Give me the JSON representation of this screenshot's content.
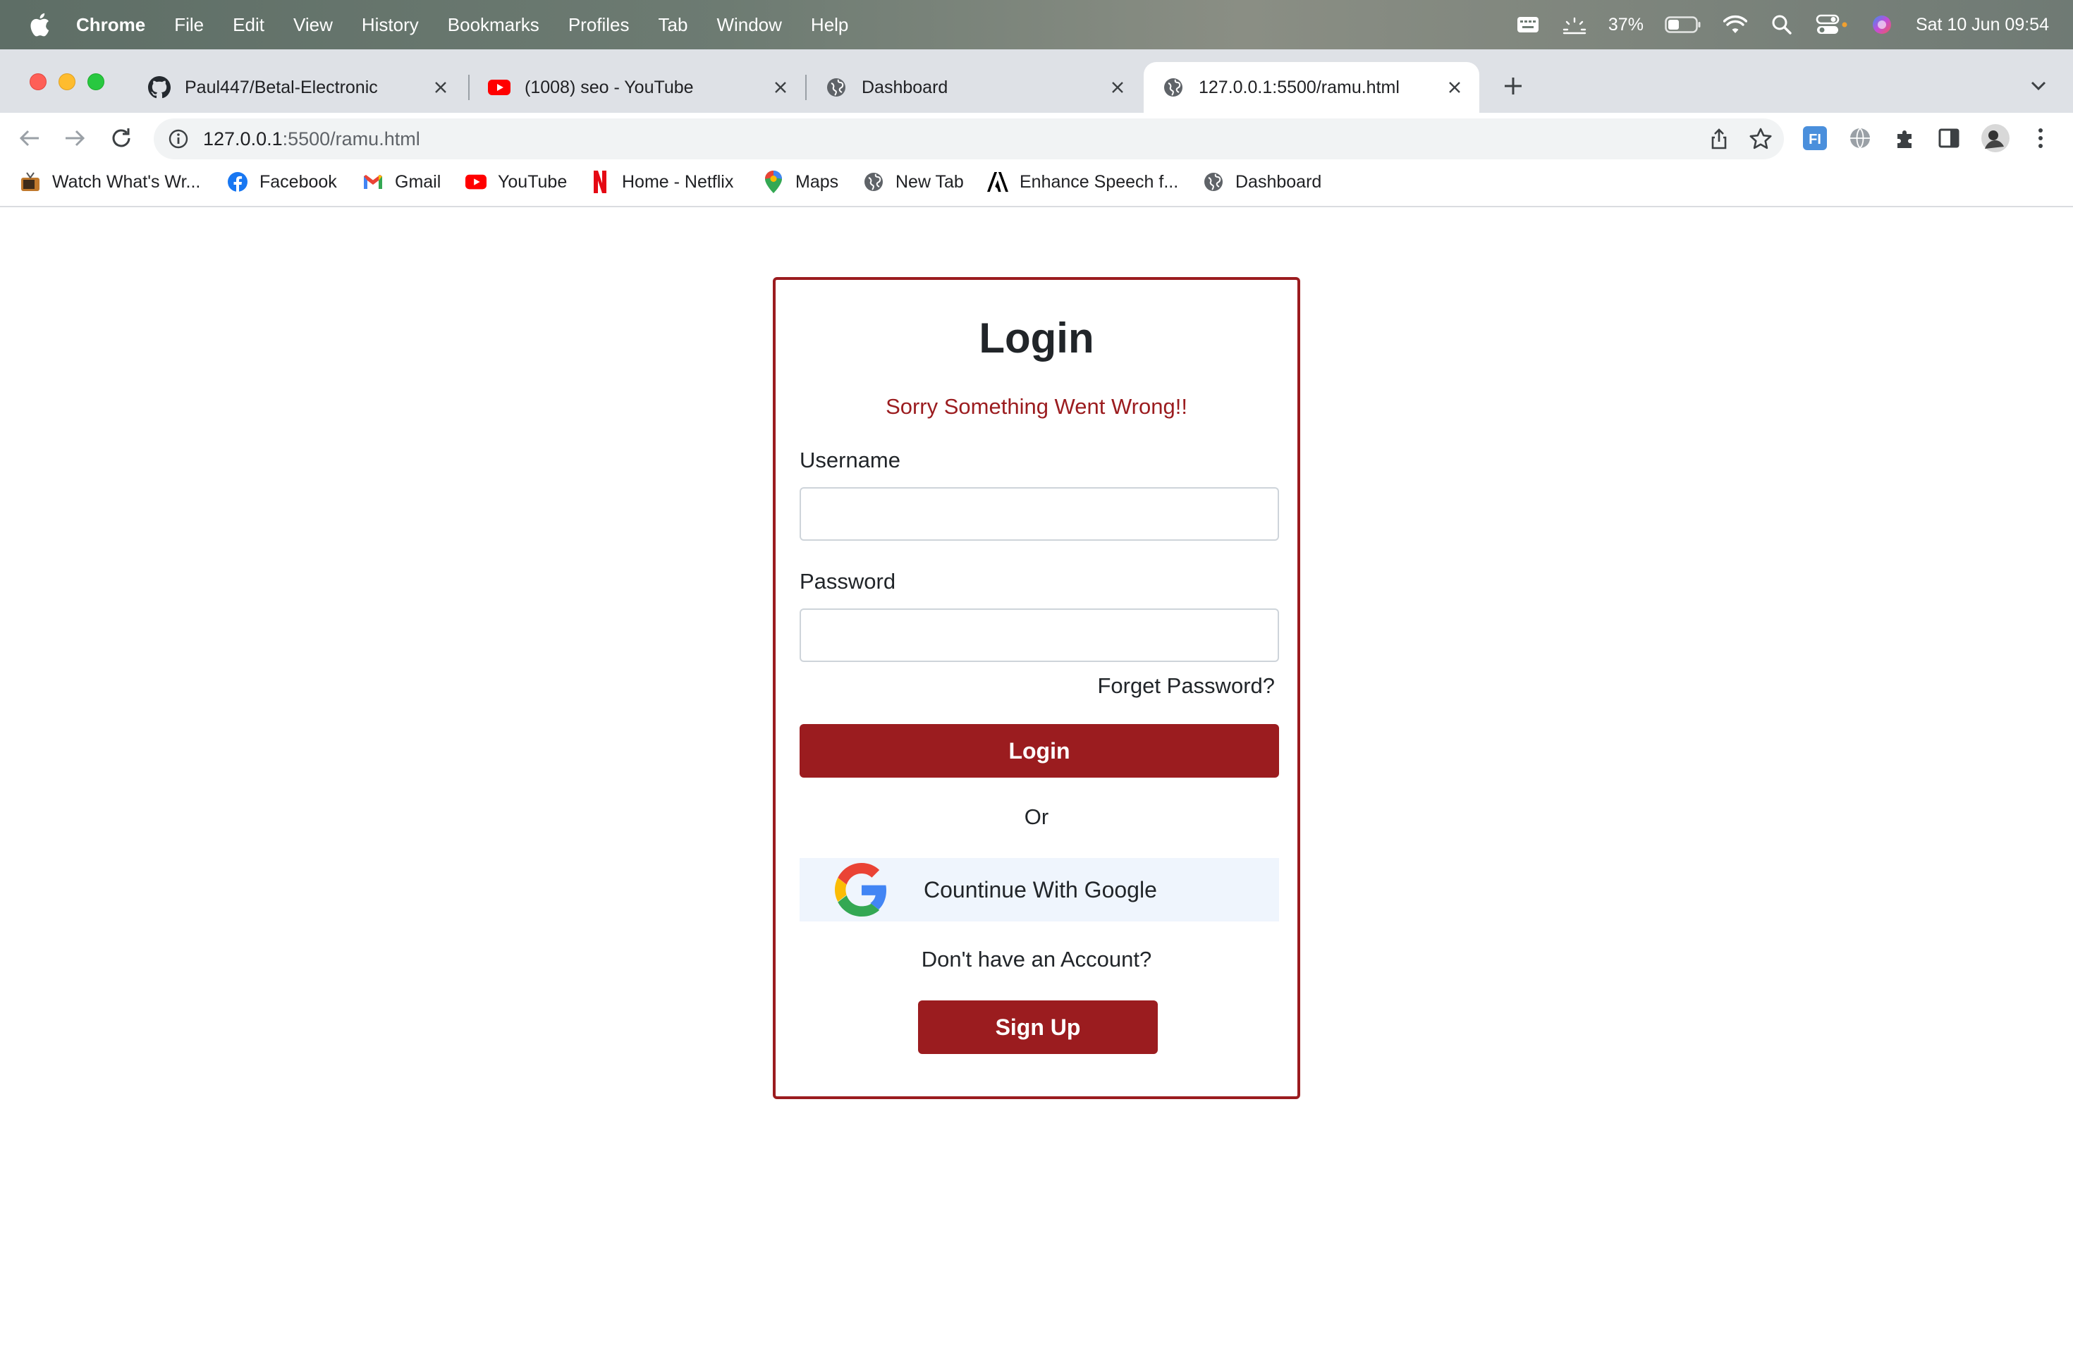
{
  "menubar": {
    "app_name": "Chrome",
    "items": [
      "File",
      "Edit",
      "View",
      "History",
      "Bookmarks",
      "Profiles",
      "Tab",
      "Window",
      "Help"
    ],
    "battery": "37%",
    "datetime": "Sat 10 Jun  09:54"
  },
  "tabs": [
    {
      "title": "Paul447/Betal-Electronic",
      "icon": "github-icon",
      "active": false
    },
    {
      "title": "(1008) seo - YouTube",
      "icon": "youtube-icon",
      "active": false
    },
    {
      "title": "Dashboard",
      "icon": "globe-icon",
      "active": false
    },
    {
      "title": "127.0.0.1:5500/ramu.html",
      "icon": "globe-icon",
      "active": true
    }
  ],
  "address_bar": {
    "host": "127.0.0.1",
    "path": ":5500/ramu.html"
  },
  "bookmarks": [
    {
      "label": "Watch What's Wr...",
      "icon": "tv-icon"
    },
    {
      "label": "Facebook",
      "icon": "facebook-icon"
    },
    {
      "label": "Gmail",
      "icon": "gmail-icon"
    },
    {
      "label": "YouTube",
      "icon": "youtube-icon"
    },
    {
      "label": "Home - Netflix",
      "icon": "netflix-icon"
    },
    {
      "label": "Maps",
      "icon": "maps-icon"
    },
    {
      "label": "New Tab",
      "icon": "globe-icon"
    },
    {
      "label": "Enhance Speech f...",
      "icon": "adobe-icon"
    },
    {
      "label": "Dashboard",
      "icon": "globe-icon"
    }
  ],
  "login": {
    "title": "Login",
    "error": "Sorry Something Went Wrong!!",
    "username_label": "Username",
    "username_value": "",
    "password_label": "Password",
    "password_value": "",
    "forget_password": "Forget Password?",
    "login_button": "Login",
    "or_text": "Or",
    "google_button": "Countinue With Google",
    "no_account": "Don't have an Account?",
    "signup_button": "Sign Up"
  },
  "colors": {
    "brand": "#9b1c1f",
    "google_button_bg": "#eff5fd"
  }
}
